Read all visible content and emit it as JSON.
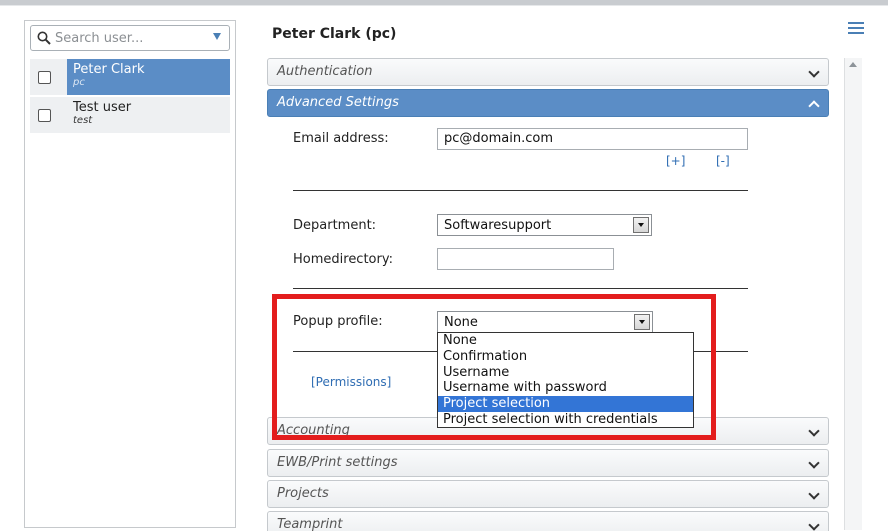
{
  "search": {
    "placeholder": "Search user..."
  },
  "users": [
    {
      "name": "Peter Clark",
      "short": "pc",
      "selected": true
    },
    {
      "name": "Test user",
      "short": "test",
      "selected": false
    }
  ],
  "header": {
    "title": "Peter Clark (pc)"
  },
  "sections": {
    "authentication": "Authentication",
    "advanced": "Advanced Settings",
    "accounting": "Accounting",
    "ewb": "EWB/Print settings",
    "projects": "Projects",
    "teamprint": "Teamprint"
  },
  "form": {
    "email_label": "Email address:",
    "email_value": "pc@domain.com",
    "add_link": "[+]",
    "remove_link": "[-]",
    "department_label": "Department:",
    "department_value": "Softwaresupport",
    "homedir_label": "Homedirectory:",
    "homedir_value": "",
    "popup_label": "Popup profile:",
    "popup_value": "None",
    "permissions_link": "[Permissions]"
  },
  "popup_options": [
    "None",
    "Confirmation",
    "Username",
    "Username with password",
    "Project selection",
    "Project selection with credentials"
  ],
  "popup_highlighted_option": "Project selection",
  "colors": {
    "accent": "#5b8dc6",
    "link": "#2f6db3",
    "highlight_box": "#e31d1d",
    "dropdown_selection": "#3375d6"
  },
  "icons": {
    "search": "search-icon",
    "menu": "hamburger-menu-icon",
    "chevron": "chevron-icon"
  }
}
